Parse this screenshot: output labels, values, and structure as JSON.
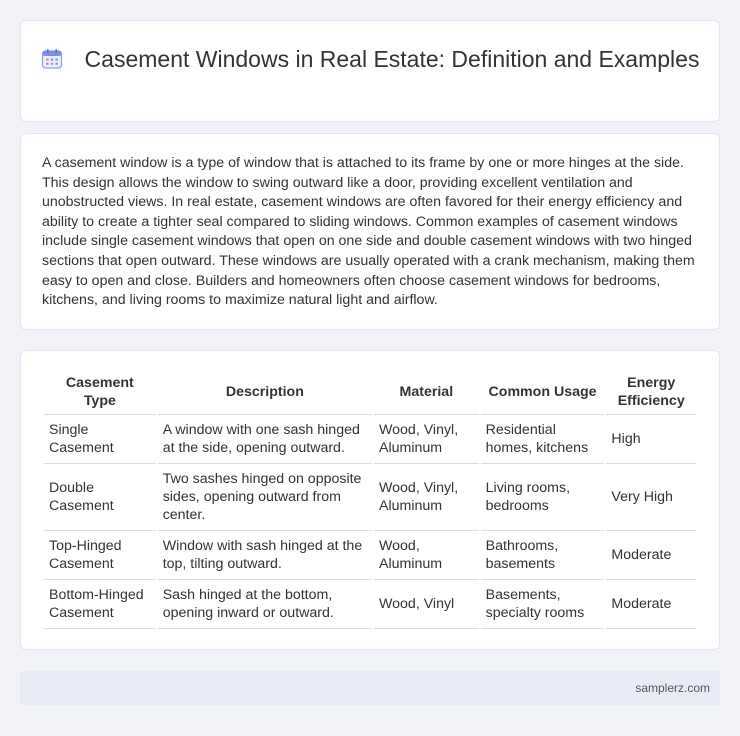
{
  "header": {
    "title": "Casement Windows in Real Estate: Definition and Examples",
    "icon": "calendar-icon"
  },
  "description": "A casement window is a type of window that is attached to its frame by one or more hinges at the side. This design allows the window to swing outward like a door, providing excellent ventilation and unobstructed views. In real estate, casement windows are often favored for their energy efficiency and ability to create a tighter seal compared to sliding windows. Common examples of casement windows include single casement windows that open on one side and double casement windows with two hinged sections that open outward. These windows are usually operated with a crank mechanism, making them easy to open and close. Builders and homeowners often choose casement windows for bedrooms, kitchens, and living rooms to maximize natural light and airflow.",
  "table": {
    "headers": [
      "Casement Type",
      "Description",
      "Material",
      "Common Usage",
      "Energy Efficiency"
    ],
    "rows": [
      [
        "Single Casement",
        "A window with one sash hinged at the side, opening outward.",
        "Wood, Vinyl, Aluminum",
        "Residential homes, kitchens",
        "High"
      ],
      [
        "Double Casement",
        "Two sashes hinged on opposite sides, opening outward from center.",
        "Wood, Vinyl, Aluminum",
        "Living rooms, bedrooms",
        "Very High"
      ],
      [
        "Top-Hinged Casement",
        "Window with sash hinged at the top, tilting outward.",
        "Wood, Aluminum",
        "Bathrooms, basements",
        "Moderate"
      ],
      [
        "Bottom-Hinged Casement",
        "Sash hinged at the bottom, opening inward or outward.",
        "Wood, Vinyl",
        "Basements, specialty rooms",
        "Moderate"
      ]
    ]
  },
  "footer": {
    "site": "samplerz.com"
  },
  "colors": {
    "background": "#f1f3f9",
    "card": "#ffffff",
    "footer": "#e8ecf6",
    "icon_accent": "#7b8fe0"
  }
}
